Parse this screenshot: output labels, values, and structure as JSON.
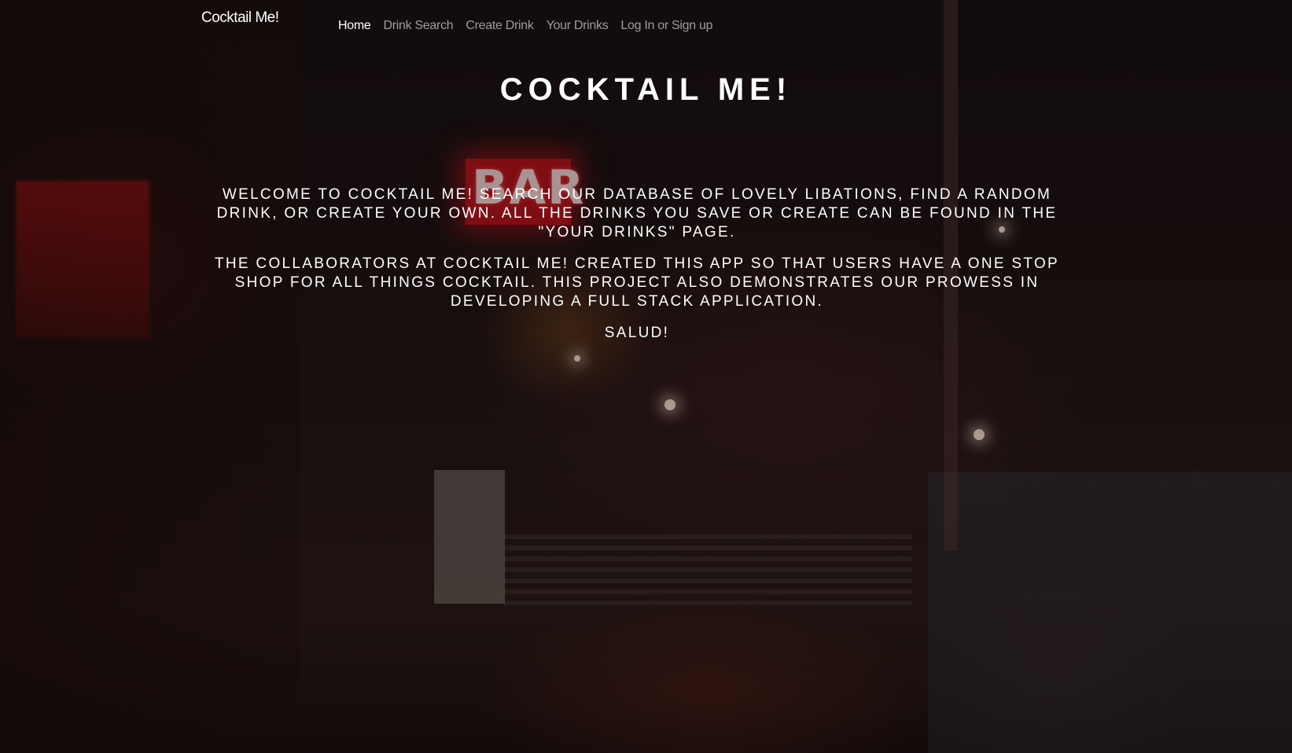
{
  "navbar": {
    "brand": "Cocktail Me!",
    "links": [
      {
        "label": "Home",
        "active": true
      },
      {
        "label": "Drink Search",
        "active": false
      },
      {
        "label": "Create Drink",
        "active": false
      },
      {
        "label": "Your Drinks",
        "active": false
      },
      {
        "label": "Log In or Sign up",
        "active": false
      }
    ]
  },
  "hero": {
    "title": "COCKTAIL ME!",
    "paragraphs": [
      "Welcome to Cocktail Me! Search our database of lovely libations, find a random drink, or create your own. All the drinks you save or create can be found in the \"Your Drinks\" page.",
      "The collaborators at Cocktail Me! created this app so that users have a one stop shop for all things cocktail. This project also demonstrates our prowess in developing a full stack application.",
      "Salud!"
    ]
  },
  "background": {
    "neon_sign_text": "BAR",
    "accent_color": "#e0141e"
  }
}
